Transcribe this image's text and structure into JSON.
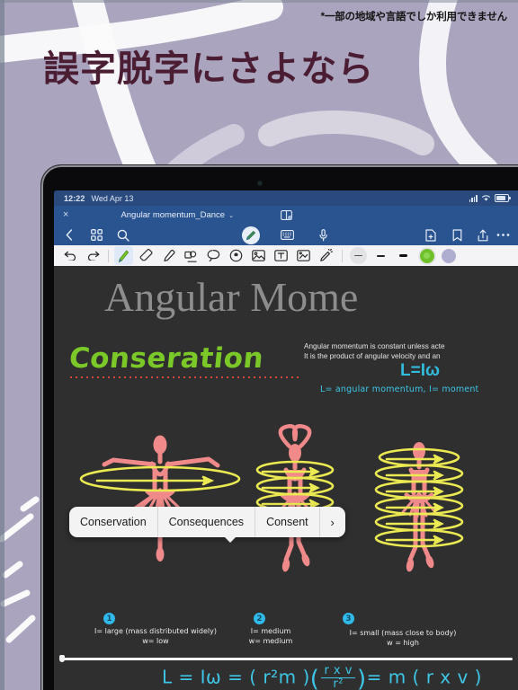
{
  "promo": {
    "note": "*一部の地域や言語でしか利用できません",
    "title": "誤字脱字にさよなら"
  },
  "tablet": {
    "status": {
      "time": "12:22",
      "date": "Wed Apr 13",
      "icons": [
        "signal-bars-icon",
        "wifi-icon",
        "battery-icon"
      ]
    },
    "titlebar": {
      "close": "×",
      "document_title": "Angular momentum_Dance",
      "caret": "⌄",
      "book_icon": "split-view-book-icon"
    },
    "toolbar": {
      "items": [
        {
          "name": "back-icon",
          "label": "Back"
        },
        {
          "name": "grid-view-icon",
          "label": "Page grid"
        },
        {
          "name": "search-icon",
          "label": "Search"
        },
        {
          "name": "pen-mode-icon",
          "label": "Pen",
          "active": true
        },
        {
          "name": "keyboard-icon",
          "label": "Keyboard"
        },
        {
          "name": "microphone-icon",
          "label": "Record audio"
        },
        {
          "name": "new-page-icon",
          "label": "New page"
        },
        {
          "name": "bookmark-icon",
          "label": "Bookmark"
        },
        {
          "name": "share-icon",
          "label": "Share"
        },
        {
          "name": "more-icon",
          "label": "More"
        }
      ]
    },
    "pentools": {
      "items": [
        {
          "name": "undo-icon",
          "label": "Undo"
        },
        {
          "name": "redo-icon",
          "label": "Redo"
        },
        {
          "name": "pen-tool-icon",
          "label": "Pen",
          "active": true
        },
        {
          "name": "eraser-tool-icon",
          "label": "Eraser"
        },
        {
          "name": "highlighter-tool-icon",
          "label": "Highlighter"
        },
        {
          "name": "shape-tool-icon",
          "label": "Shapes"
        },
        {
          "name": "lasso-tool-icon",
          "label": "Lasso select"
        },
        {
          "name": "sticker-tool-icon",
          "label": "Sticker"
        },
        {
          "name": "image-tool-icon",
          "label": "Insert image"
        },
        {
          "name": "text-box-tool-icon",
          "label": "Text box"
        },
        {
          "name": "crop-tool-icon",
          "label": "Crop"
        },
        {
          "name": "laser-pointer-icon",
          "label": "Laser pointer"
        }
      ],
      "stroke_widths": [
        "thin",
        "medium",
        "thick"
      ],
      "colors": [
        {
          "name": "green-swatch",
          "hex": "#6fc02b",
          "selected": true
        },
        {
          "name": "lavender-swatch",
          "hex": "#b0aed0",
          "selected": false
        }
      ]
    },
    "note": {
      "page_title": "Angular Mome",
      "handwritten_heading": "Conseration",
      "paragraph_line1": "Angular momentum is constant unless acte",
      "paragraph_line2": "It is the product of angular velocity and an",
      "formula_inline": "L=Iω",
      "handwritten_legend": "L= angular momentum, I= moment",
      "bottom_formula": {
        "prefix": "L = Iω = ( r²m )",
        "numerator": "r x v",
        "denominator": "r²",
        "suffix": "= m ( r x v )"
      },
      "figures": [
        {
          "badge": "1",
          "line1": "I= large (mass distributed widely)",
          "line2": "w= low"
        },
        {
          "badge": "2",
          "line1": "I= medium",
          "line2": "w= medium"
        },
        {
          "badge": "3",
          "line1": "I= small (mass close to body)",
          "line2": "w = high"
        }
      ],
      "ink_colors": {
        "green": "#7bc928",
        "cyan": "#3ec6e6",
        "pink": "#f08a8a",
        "yellow": "#ecea52",
        "spellcheck_red": "#d8453c"
      }
    },
    "suggestions": {
      "items": [
        "Conservation",
        "Consequences",
        "Consent"
      ],
      "more": "›"
    }
  }
}
